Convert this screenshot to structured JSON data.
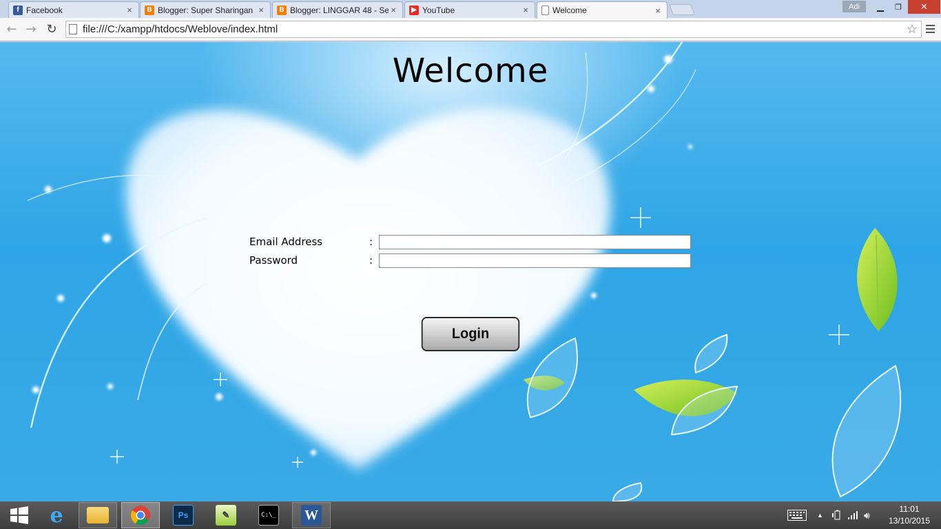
{
  "browser": {
    "tabs": [
      {
        "title": "Facebook",
        "icon": "facebook-icon",
        "color": "#3b5998",
        "active": false
      },
      {
        "title": "Blogger: Super Sharingan",
        "icon": "blogger-icon",
        "color": "#f57d00",
        "active": false
      },
      {
        "title": "Blogger: LINGGAR 48 - Se",
        "icon": "blogger-icon",
        "color": "#f57d00",
        "active": false
      },
      {
        "title": "YouTube",
        "icon": "youtube-icon",
        "color": "#e52d27",
        "active": false
      },
      {
        "title": "Welcome",
        "icon": "page-icon",
        "color": "#ffffff",
        "active": true
      }
    ],
    "close_glyph": "×",
    "profile_name": "Adi",
    "url": "file:///C:/xampp/htdocs/Weblove/index.html"
  },
  "page": {
    "title": "Welcome",
    "email_label": "Email Address",
    "password_label": "Password",
    "colon": ":",
    "email_value": "",
    "password_value": "",
    "login_label": "Login"
  },
  "taskbar": {
    "apps": [
      "start-icon",
      "internet-explorer-icon",
      "file-explorer-icon",
      "chrome-icon",
      "photoshop-icon",
      "notepad-plus-plus-icon",
      "command-prompt-icon",
      "word-icon"
    ],
    "photoshop_text": "Ps",
    "cmd_text": "C:\\_",
    "word_text": "W",
    "time": "11:01",
    "date": "13/10/2015"
  }
}
